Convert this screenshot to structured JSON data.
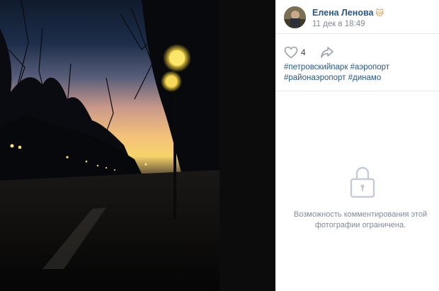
{
  "photo": {
    "alt": "Вечерний парк с фонарями на фоне заката"
  },
  "post": {
    "author_name": "Елена Ленова",
    "author_emoji": "🐱",
    "date": "11 дек в 18:49",
    "likes": "4",
    "hashtags": [
      "#петровскийпарк",
      "#аэропорт",
      "#районаэропорт",
      "#динамо"
    ]
  },
  "comments": {
    "restricted_message": "Возможность комментирования этой фотографии ограничена."
  },
  "colors": {
    "link": "#2a5885",
    "muted": "#828a99",
    "divider": "#e7e8ec",
    "icon": "#99a2ad"
  },
  "icons": {
    "like": "heart-icon",
    "share": "share-arrow-icon",
    "lock": "lock-icon"
  }
}
